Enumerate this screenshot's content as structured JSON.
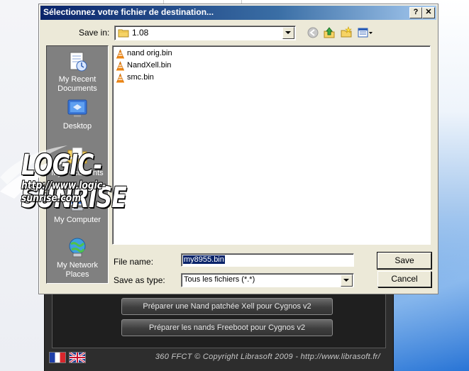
{
  "dialog": {
    "title": "Sélectionnez votre fichier de destination...",
    "help_glyph": "?",
    "close_glyph": "✕",
    "save_in_label": "Save in:",
    "save_in_value": "1.08",
    "places": [
      {
        "label": "My Recent Documents",
        "icon": "recent-documents-icon"
      },
      {
        "label": "Desktop",
        "icon": "desktop-icon"
      },
      {
        "label": "My Documents",
        "icon": "my-documents-icon"
      },
      {
        "label": "My Computer",
        "icon": "my-computer-icon"
      },
      {
        "label": "My Network Places",
        "icon": "network-places-icon"
      }
    ],
    "files": [
      "nand orig.bin",
      "NandXell.bin",
      "smc.bin"
    ],
    "filename_label": "File name:",
    "filename_value": "my8955.bin",
    "type_label": "Save as type:",
    "type_value": "Tous les fichiers (*.*)",
    "save_label": "Save",
    "cancel_label": "Cancel"
  },
  "background_app": {
    "button1_label": "Préparer une Nand patchée Xell pour Cygnos v2",
    "button2_label": "Préparer les nands Freeboot pour Cygnos v2",
    "copyright": "360 FFCT © Copyright Librasoft 2009 - http://www.librasoft.fr/"
  },
  "watermark": {
    "title": "LOGIC-SUNRISE",
    "url": "http://www.logic-sunrise.com"
  },
  "colors": {
    "titlebar_start": "#0a246a",
    "dialog_face": "#ece9d8",
    "places_bar": "#808080",
    "selection": "#0a246a"
  }
}
